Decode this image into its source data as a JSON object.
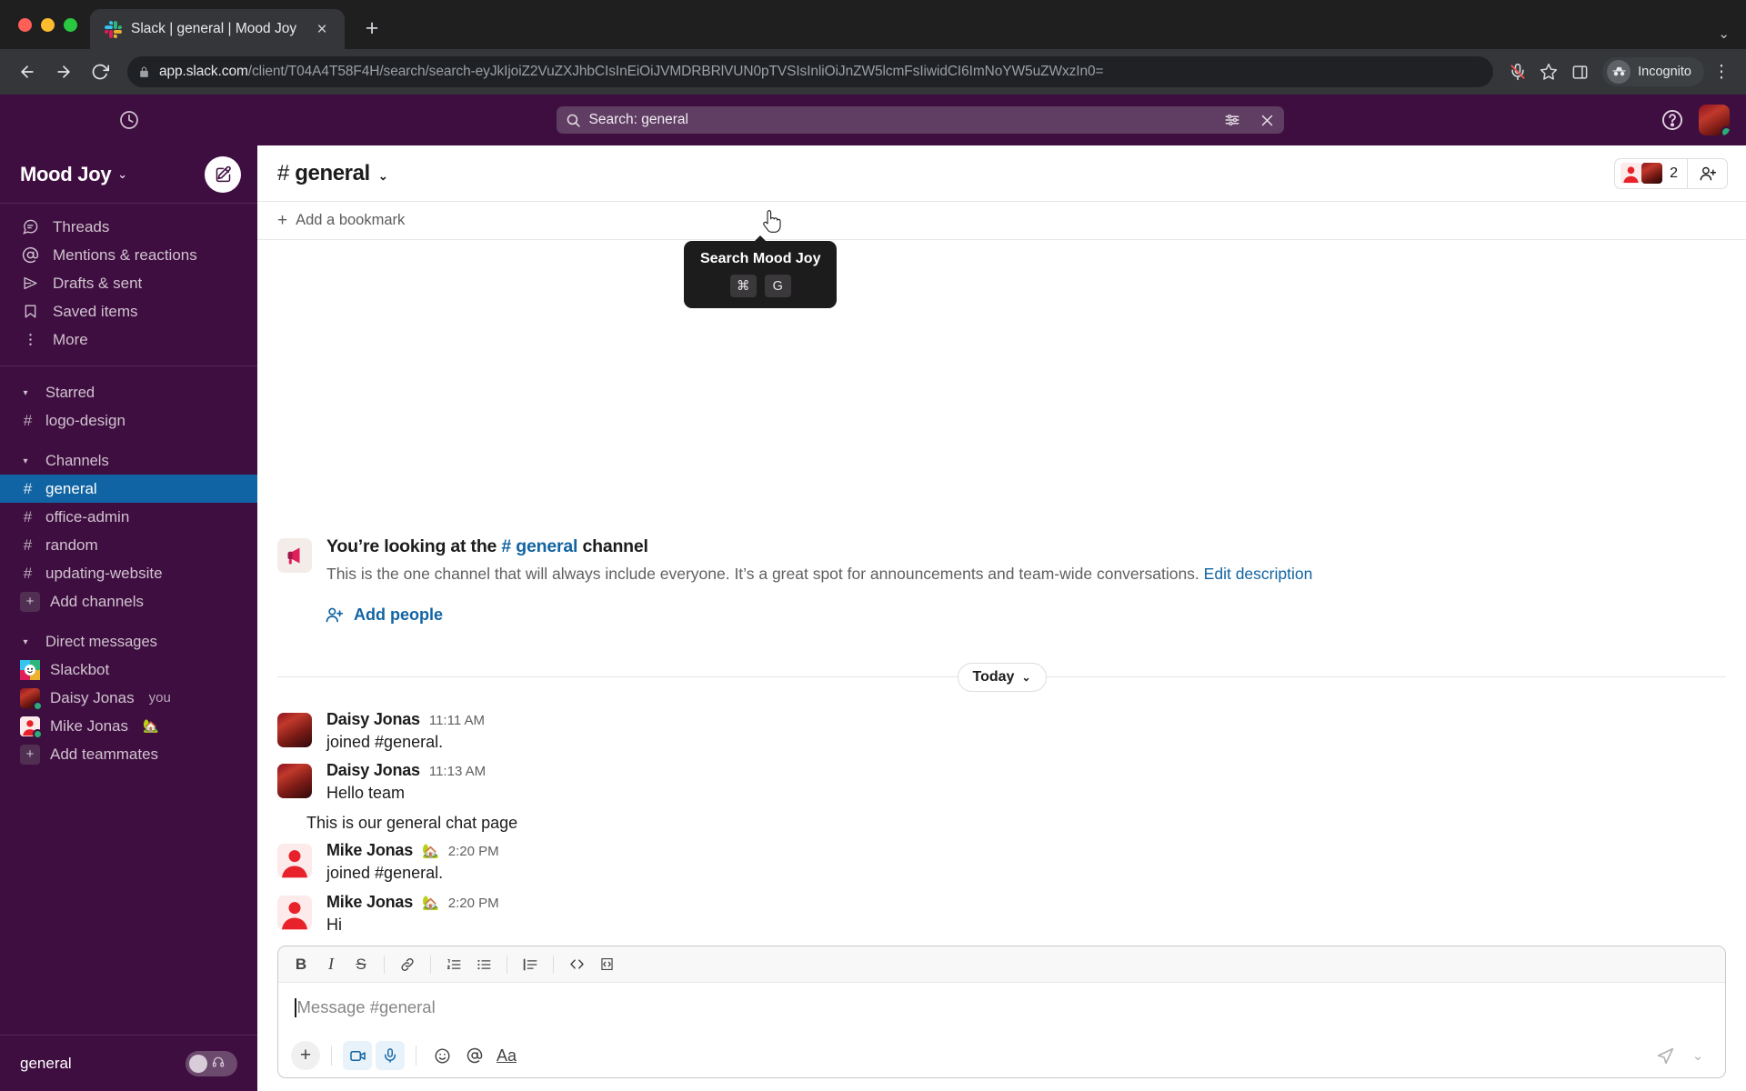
{
  "browser": {
    "tab": {
      "title": "Slack | general | Mood Joy",
      "favicon": "slack-icon",
      "close": "×"
    },
    "new_tab": "+",
    "window_menu": "⌄",
    "nav": {
      "back": "←",
      "forward": "→",
      "reload": "⟳"
    },
    "url": {
      "lock": "lock-icon",
      "domain": "app.slack.com",
      "path": "/client/T04A4T58F4H/search/search-eyJkIjoiZ2VuZXJhbCIsInEiOiJVMDRBRlVUN0pTVSIsInliOiJnZW5lcmFsIiwidCI6ImNoYW5uZWxzIn0="
    },
    "toolbar_icons": {
      "mic": "mic-muted-icon",
      "star": "bookmark-star-icon",
      "panel": "side-panel-icon",
      "menu": "⋮"
    },
    "incognito_label": "Incognito"
  },
  "topbar": {
    "history_icon": "clock-history-icon",
    "search": {
      "icon": "search-icon",
      "value": "Search: general",
      "filter_icon": "filter-icon",
      "clear_icon": "×"
    },
    "help_icon": "help-circle-icon",
    "avatar": "user-avatar"
  },
  "tooltip": {
    "title": "Search Mood Joy",
    "keys": [
      "⌘",
      "G"
    ]
  },
  "sidebar": {
    "workspace": {
      "name": "Mood Joy",
      "caret": "⌄"
    },
    "compose_icon": "compose-pencil-icon",
    "nav": [
      {
        "label": "Threads",
        "icon": "threads-icon"
      },
      {
        "label": "Mentions & reactions",
        "icon": "at-icon"
      },
      {
        "label": "Drafts & sent",
        "icon": "paper-plane-icon"
      },
      {
        "label": "Saved items",
        "icon": "bookmark-icon"
      },
      {
        "label": "More",
        "icon": "more-vertical-icon"
      }
    ],
    "starred": {
      "label": "Starred",
      "caret": "▾",
      "items": [
        {
          "label": "logo-design",
          "prefix": "#"
        }
      ]
    },
    "channels": {
      "label": "Channels",
      "caret": "▾",
      "items": [
        {
          "label": "general",
          "prefix": "#",
          "active": true
        },
        {
          "label": "office-admin",
          "prefix": "#",
          "active": false
        },
        {
          "label": "random",
          "prefix": "#",
          "active": false
        },
        {
          "label": "updating-website",
          "prefix": "#",
          "active": false
        }
      ],
      "add_label": "Add channels",
      "add_prefix": "+"
    },
    "dms": {
      "label": "Direct messages",
      "caret": "▾",
      "items": [
        {
          "label": "Slackbot",
          "avatar": "slackbot",
          "presence": false,
          "suffix": "",
          "emoji": ""
        },
        {
          "label": "Daisy Jonas",
          "avatar": "flowers",
          "presence": true,
          "suffix": "you",
          "emoji": ""
        },
        {
          "label": "Mike Jonas",
          "avatar": "person",
          "presence": true,
          "suffix": "",
          "emoji": "🏡"
        }
      ],
      "add_label": "Add teammates",
      "add_prefix": "+"
    },
    "footer": {
      "label": "general",
      "headset_icon": "headphones-icon"
    }
  },
  "channel": {
    "name": "general",
    "hash": "#",
    "caret": "⌄",
    "members_count": "2",
    "add_member_icon": "add-person-icon",
    "bookmark_label": "Add a bookmark",
    "bookmark_plus": "+"
  },
  "intro": {
    "icon": "megaphone-icon",
    "heading_pre": "You’re looking at the ",
    "heading_channel": "# general",
    "heading_post": " channel",
    "description": "This is the one channel that will always include everyone. It’s a great spot for announcements and team-wide conversations.",
    "edit_link": "Edit description",
    "add_people": "Add people",
    "add_people_icon": "add-person-icon"
  },
  "date_divider": {
    "label": "Today",
    "caret": "⌄"
  },
  "messages": [
    {
      "author": "Daisy Jonas",
      "emoji": "",
      "time": "11:11 AM",
      "text": "joined #general.",
      "avatar": "flowers",
      "continuation": false
    },
    {
      "author": "Daisy Jonas",
      "emoji": "",
      "time": "11:13 AM",
      "text": "Hello team",
      "avatar": "flowers",
      "continuation": false
    },
    {
      "author": "",
      "emoji": "",
      "time": "",
      "text": "This is our general chat page",
      "avatar": "",
      "continuation": true
    },
    {
      "author": "Mike Jonas",
      "emoji": "🏡",
      "time": "2:20 PM",
      "text": "joined #general.",
      "avatar": "person",
      "continuation": false
    },
    {
      "author": "Mike Jonas",
      "emoji": "🏡",
      "time": "2:20 PM",
      "text": "Hi",
      "avatar": "person",
      "continuation": false
    }
  ],
  "composer": {
    "placeholder": "Message #general",
    "format_buttons": [
      {
        "name": "bold",
        "glyph": "B"
      },
      {
        "name": "italic",
        "glyph": "I"
      },
      {
        "name": "strikethrough",
        "glyph": "S"
      },
      {
        "name": "link",
        "glyph": "link"
      },
      {
        "name": "ordered-list",
        "glyph": "ol"
      },
      {
        "name": "bulleted-list",
        "glyph": "ul"
      },
      {
        "name": "blockquote",
        "glyph": "quote"
      },
      {
        "name": "code",
        "glyph": "code"
      },
      {
        "name": "code-block",
        "glyph": "codeblock"
      }
    ],
    "action_buttons": [
      {
        "name": "attach",
        "glyph": "+"
      },
      {
        "name": "video-clip",
        "glyph": "video"
      },
      {
        "name": "audio-clip",
        "glyph": "mic"
      },
      {
        "name": "emoji",
        "glyph": "emoji"
      },
      {
        "name": "mention",
        "glyph": "@"
      },
      {
        "name": "formatting",
        "glyph": "Aa"
      }
    ],
    "send_icon": "send-icon",
    "send_caret": "⌄"
  },
  "colors": {
    "slack_purple": "#3F0E40",
    "active_channel": "#1164A3",
    "link_blue": "#1264A3",
    "presence_green": "#2BAC76"
  }
}
